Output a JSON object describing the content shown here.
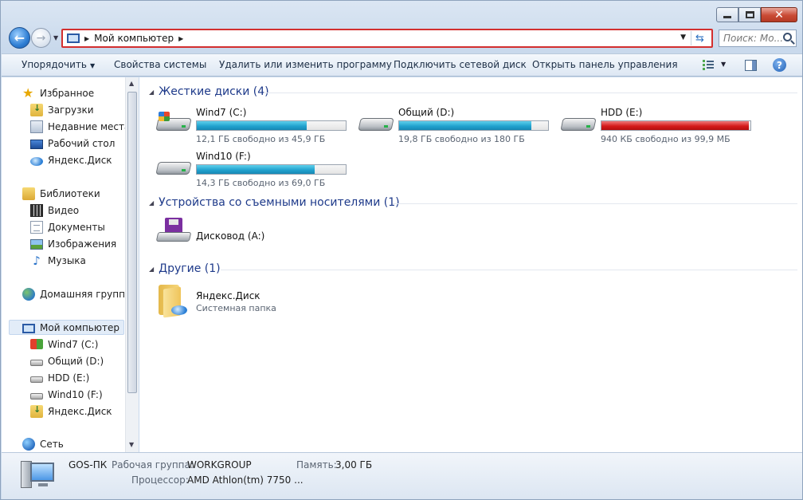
{
  "window": {
    "address_crumb": "Мой компьютер",
    "search_placeholder": "Поиск: Мо...",
    "close_glyph": "✕"
  },
  "toolbar": {
    "organize": "Упорядочить",
    "system_props": "Свойства системы",
    "uninstall": "Удалить или изменить программу",
    "map_drive": "Подключить сетевой диск",
    "control_panel": "Открыть панель управления",
    "help": "?"
  },
  "sidebar": {
    "favorites": "Избранное",
    "downloads": "Загрузки",
    "recent": "Недавние места",
    "desktop": "Рабочий стол",
    "ydisk": "Яндекс.Диск",
    "libraries": "Библиотеки",
    "video": "Видео",
    "documents": "Документы",
    "images": "Изображения",
    "music": "Музыка",
    "homegroup": "Домашняя группа",
    "computer": "Мой компьютер",
    "c": "Wind7 (C:)",
    "d": "Общий (D:)",
    "e": "HDD (E:)",
    "f": "Wind10 (F:)",
    "ydisk2": "Яндекс.Диск",
    "network": "Сеть"
  },
  "groups": {
    "hdd": "Жесткие диски (4)",
    "removable": "Устройства со съемными носителями (1)",
    "other": "Другие (1)"
  },
  "drives": [
    {
      "name": "Wind7 (C:)",
      "free": "12,1 ГБ свободно из 45,9 ГБ",
      "used_fraction": 0.736,
      "status_color": "#22a3cf"
    },
    {
      "name": "Общий (D:)",
      "free": "19,8 ГБ свободно из 180 ГБ",
      "used_fraction": 0.89,
      "status_color": "#22a3cf"
    },
    {
      "name": "HDD (E:)",
      "free": "940 КБ свободно из 99,9 МБ",
      "used_fraction": 0.99,
      "status_color": "#d51b1b"
    },
    {
      "name": "Wind10 (F:)",
      "free": "14,3 ГБ свободно из 69,0 ГБ",
      "used_fraction": 0.79,
      "status_color": "#22a3cf"
    }
  ],
  "removable": {
    "name": "Дисковод (A:)"
  },
  "other": {
    "name": "Яндекс.Диск",
    "subtitle": "Системная папка"
  },
  "details": {
    "pc_name": "GOS-ПК",
    "workgroup_label": "Рабочая группа:",
    "workgroup_value": "WORKGROUP",
    "memory_label": "Память:",
    "memory_value": "3,00 ГБ",
    "cpu_label": "Процессор:",
    "cpu_value": "AMD Athlon(tm) 7750 ..."
  }
}
